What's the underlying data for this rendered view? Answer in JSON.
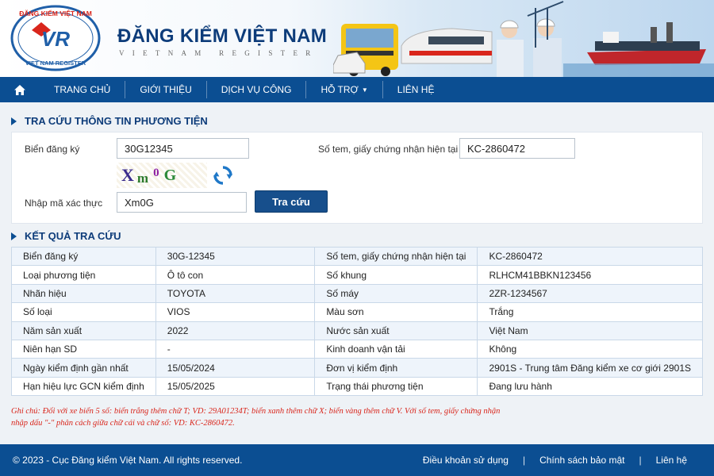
{
  "header": {
    "logo_text_top": "ĐĂNG KIỂM VIỆT NAM",
    "logo_text_bottom": "VIET NAM REGISTER",
    "logo_mark": "VR",
    "title": "ĐĂNG KIỂM VIỆT NAM",
    "subtitle": "VIETNAM REGISTER"
  },
  "nav": {
    "home_icon": "home-icon",
    "items": [
      "TRANG CHỦ",
      "GIỚI THIỆU",
      "DỊCH VỤ CÔNG",
      "HỖ TRỢ",
      "LIÊN HỆ"
    ]
  },
  "search": {
    "section_title": "TRA CỨU THÔNG TIN PHƯƠNG TIỆN",
    "plate_label": "Biển đăng ký",
    "plate_value": "30G12345",
    "stamp_label": "Số tem, giấy chứng nhận hiện tại",
    "stamp_value": "KC-2860472",
    "captcha_chars": [
      "X",
      "m",
      "0",
      "G"
    ],
    "captcha_label": "Nhập mã xác thực",
    "captcha_value": "Xm0G",
    "submit_label": "Tra cứu"
  },
  "results": {
    "section_title": "KẾT QUẢ TRA CỨU",
    "rows": [
      [
        "Biển đăng ký",
        "30G-12345",
        "Số tem, giấy chứng nhận hiện tại",
        "KC-2860472"
      ],
      [
        "Loại phương tiện",
        "Ô tô con",
        "Số khung",
        "RLHCM41BBKN123456"
      ],
      [
        "Nhãn hiệu",
        "TOYOTA",
        "Số máy",
        "2ZR-1234567"
      ],
      [
        "Số loại",
        "VIOS",
        "Màu sơn",
        "Trắng"
      ],
      [
        "Năm sản xuất",
        "2022",
        "Nước sản xuất",
        "Việt Nam"
      ],
      [
        "Niên hạn SD",
        "-",
        "Kinh doanh vận tải",
        "Không"
      ],
      [
        "Ngày kiểm định gần nhất",
        "15/05/2024",
        "Đơn vị kiểm định",
        "2901S - Trung tâm Đăng kiểm xe cơ giới 2901S"
      ],
      [
        "Hạn hiệu lực GCN kiểm định",
        "15/05/2025",
        "Trạng thái phương tiện",
        "Đang lưu hành"
      ]
    ]
  },
  "note": {
    "line1": "Ghi chú: Đối với xe biển 5 số: biển trắng thêm chữ T; VD: 29A01234T; biển xanh thêm chữ X; biển vàng thêm chữ V. Với số tem, giấy chứng nhận",
    "line2": "nhập dấu \"-\" phân cách giữa chữ cái và chữ số: VD: KC-2860472."
  },
  "footer": {
    "copyright": "© 2023 - Cục Đăng kiểm Việt Nam. All rights reserved.",
    "links": [
      "Điều khoản sử dụng",
      "Chính sách bảo mật",
      "Liên hệ"
    ]
  },
  "colors": {
    "primary": "#0b4e92",
    "title": "#0d3c7a",
    "note": "#d9261c",
    "row_alt": "#eef4fb"
  }
}
